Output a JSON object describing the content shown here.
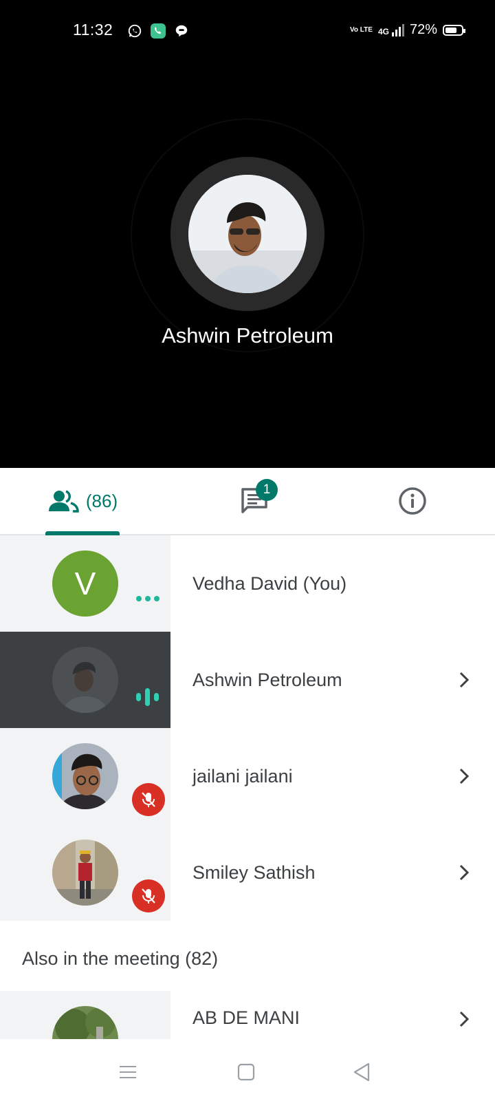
{
  "status_bar": {
    "time": "11:32",
    "network_label": "Vo LTE",
    "signal_label": "4G",
    "battery": "72%",
    "battery_level": 0.72
  },
  "speaker": {
    "name": "Ashwin Petroleum"
  },
  "tabs": {
    "people_count": "(86)",
    "chat_badge": "1"
  },
  "participants": [
    {
      "name": "Vedha David (You)",
      "initial": "V",
      "avatar_color": "#6aa331",
      "indicator": "more"
    },
    {
      "name": "Ashwin Petroleum",
      "indicator": "speaking"
    },
    {
      "name": "jailani jailani",
      "indicator": "muted"
    },
    {
      "name": "Smiley Sathish",
      "indicator": "muted"
    }
  ],
  "also_in_meeting": {
    "title": "Also in the meeting (82)",
    "first_partial_name": "AB DE MANI"
  },
  "colors": {
    "accent": "#00796b",
    "muted_red": "#d93025",
    "speaking_teal": "#2ed1b4"
  }
}
